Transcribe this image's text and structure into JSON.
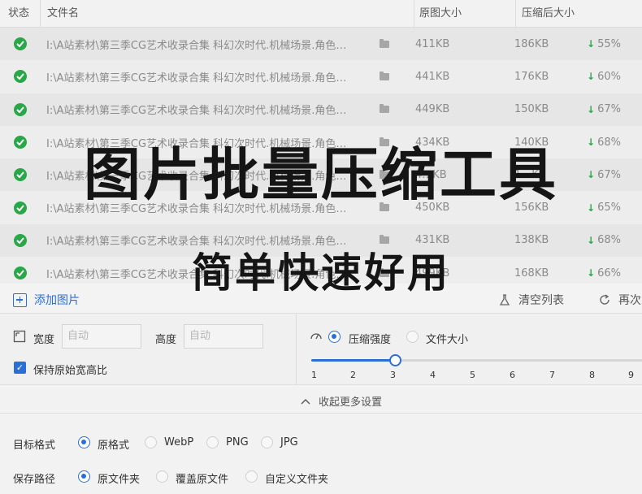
{
  "table": {
    "columns": {
      "status": "状态",
      "filename": "文件名",
      "original_size": "原图大小",
      "compressed_size": "压缩后大小"
    },
    "rows": [
      {
        "status_icon": "check-circle-icon",
        "filename": "I:\\A站素材\\第三季CG艺术收录合集 科幻次时代.机械场景.角色…",
        "original_size": "411KB",
        "compressed_size": "186KB",
        "reduction": "55%"
      },
      {
        "status_icon": "check-circle-icon",
        "filename": "I:\\A站素材\\第三季CG艺术收录合集 科幻次时代.机械场景.角色…",
        "original_size": "441KB",
        "compressed_size": "176KB",
        "reduction": "60%"
      },
      {
        "status_icon": "check-circle-icon",
        "filename": "I:\\A站素材\\第三季CG艺术收录合集 科幻次时代.机械场景.角色…",
        "original_size": "449KB",
        "compressed_size": "150KB",
        "reduction": "67%"
      },
      {
        "status_icon": "check-circle-icon",
        "filename": "I:\\A站素材\\第三季CG艺术收录合集 科幻次时代.机械场景.角色…",
        "original_size": "434KB",
        "compressed_size": "140KB",
        "reduction": "68%"
      },
      {
        "status_icon": "check-circle-icon",
        "filename": "I:\\A站素材\\第三季CG艺术收录合集 科幻次时代.机械场景.角色…",
        "original_size": "4…KB",
        "compressed_size": "1…KB",
        "reduction": "67%"
      },
      {
        "status_icon": "check-circle-icon",
        "filename": "I:\\A站素材\\第三季CG艺术收录合集 科幻次时代.机械场景.角色…",
        "original_size": "450KB",
        "compressed_size": "156KB",
        "reduction": "65%"
      },
      {
        "status_icon": "check-circle-icon",
        "filename": "I:\\A站素材\\第三季CG艺术收录合集 科幻次时代.机械场景.角色…",
        "original_size": "431KB",
        "compressed_size": "138KB",
        "reduction": "68%"
      },
      {
        "status_icon": "check-circle-icon",
        "filename": "I:\\A站素材\\第三季CG艺术收录合集 科幻次时代.机械场景.角色…",
        "original_size": "499KB",
        "compressed_size": "168KB",
        "reduction": "66%"
      }
    ]
  },
  "toolbar": {
    "add_label": "添加图片",
    "clear_label": "清空列表",
    "redo_label": "再次"
  },
  "size_settings": {
    "width_label": "宽度",
    "width_placeholder": "自动",
    "height_label": "高度",
    "height_placeholder": "自动",
    "keep_ratio_label": "保持原始宽高比",
    "keep_ratio_checked": true
  },
  "compress_mode": {
    "strength_label": "压缩强度",
    "filesize_label": "文件大小",
    "selected": "压缩强度",
    "slider_value": 3,
    "ticks": [
      "1",
      "2",
      "3",
      "4",
      "5",
      "6",
      "7",
      "8",
      "9"
    ]
  },
  "collapse_label": "收起更多设置",
  "target_format": {
    "label": "目标格式",
    "options": [
      "原格式",
      "WebP",
      "PNG",
      "JPG"
    ],
    "selected": "原格式"
  },
  "save_path": {
    "label": "保存路径",
    "options": [
      "原文件夹",
      "覆盖原文件",
      "自定义文件夹"
    ],
    "selected": "原文件夹"
  },
  "overlay": {
    "title": "图片批量压缩工具",
    "subtitle": "简单快速好用"
  },
  "colors": {
    "accent": "#2b6fd6",
    "success": "#2aa748"
  }
}
